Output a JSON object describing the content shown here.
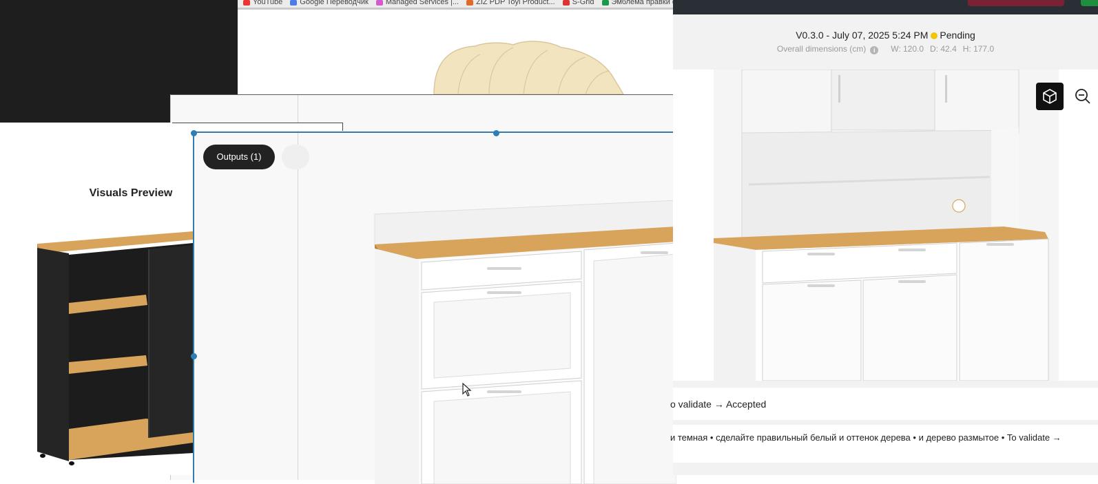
{
  "bookmarks": [
    {
      "label": "YouTube",
      "color": "#e33"
    },
    {
      "label": "Google Переводчик",
      "color": "#4a7de8"
    },
    {
      "label": "Managed Services |...",
      "color": "#d45ad0"
    },
    {
      "label": "ZIZ PDP Toyl Product...",
      "color": "#e06a2a"
    },
    {
      "label": "S-Grid",
      "color": "#d33"
    },
    {
      "label": "Эмблема правки от...",
      "color": "#1a9a4a"
    }
  ],
  "left_card": {
    "title": "Visuals Preview"
  },
  "toolbar": {
    "outputs_label": "Outputs (1)"
  },
  "header": {
    "version": "V0.3.0 - July 07, 2025 5:24 PM",
    "status": "Pending",
    "status_color": "#f2c500",
    "dimensions_label": "Overall dimensions (cm)",
    "info_glyph": "i",
    "width": "W: 120.0",
    "depth": "D: 42.4",
    "height": "H: 177.0"
  },
  "viewer_controls": {
    "view3d_icon": "cube-icon",
    "zoom_icon": "zoom-out-icon"
  },
  "history": [
    {
      "text": "o validate → Accepted"
    },
    {
      "text": "и темная • сделайте правильный белый и оттенок дерева • и дерево размытое • To validate →"
    }
  ],
  "colors": {
    "accent": "#2f7db5",
    "topbar": "#2a2f36",
    "reject_button": "#7a2234",
    "accept_button": "#1f8f3f",
    "wood": "#d8a45c"
  }
}
